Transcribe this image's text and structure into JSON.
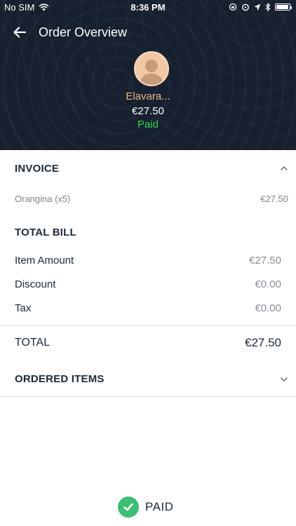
{
  "status_bar": {
    "carrier": "No SIM",
    "time": "8:36 PM"
  },
  "nav": {
    "title": "Order Overview"
  },
  "customer": {
    "name": "Elavara...",
    "amount": "€27.50",
    "status": "Paid",
    "status_color": "#2fd14a"
  },
  "invoice": {
    "title": "INVOICE",
    "item_label": "Orangina (x5)",
    "item_value": "€27.50"
  },
  "total_bill": {
    "title": "TOTAL BILL",
    "rows": [
      {
        "label": "Item Amount",
        "value": "€27.50"
      },
      {
        "label": "Discount",
        "value": "€0.00"
      },
      {
        "label": "Tax",
        "value": "€0.00"
      }
    ],
    "total_label": "TOTAL",
    "total_value": "€27.50"
  },
  "ordered_items": {
    "title": "ORDERED ITEMS"
  },
  "footer": {
    "paid_label": "PAID",
    "accent": "#3cbf72"
  }
}
